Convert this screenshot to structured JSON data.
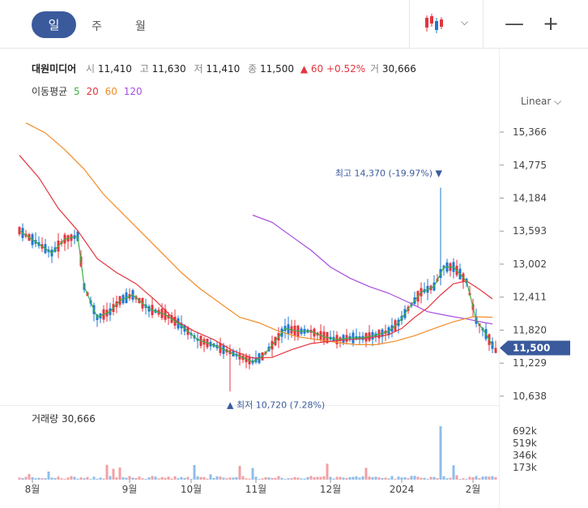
{
  "toolbar": {
    "periods": [
      {
        "label": "일",
        "active": true
      },
      {
        "label": "주",
        "active": false
      },
      {
        "label": "월",
        "active": false
      }
    ],
    "chart_type_icon": "candlestick-icon",
    "dropdown_icon": "chevron-down-icon",
    "zoom_out": "—",
    "zoom_in": "+"
  },
  "quote": {
    "name": "대원미디어",
    "open_label": "시",
    "open": "11,410",
    "high_label": "고",
    "high": "11,630",
    "low_label": "저",
    "low": "11,410",
    "close_label": "종",
    "close": "11,500",
    "change": "▲ 60",
    "change_pct": "+0.52%",
    "volume_label": "거",
    "volume": "30,666"
  },
  "moving_avg": {
    "label": "이동평균",
    "periods": [
      {
        "label": "5",
        "color": "#3cb043"
      },
      {
        "label": "20",
        "color": "#e5343e"
      },
      {
        "label": "60",
        "color": "#f28c28"
      },
      {
        "label": "120",
        "color": "#a64ddf"
      }
    ]
  },
  "scale_mode": "Linear",
  "colors": {
    "up": "#e5343e",
    "down": "#1f78d1",
    "accent": "#3a5a9c"
  },
  "chart_data": {
    "type": "candlestick",
    "y_ticks": [
      "15,366",
      "14,775",
      "14,184",
      "13,593",
      "13,002",
      "12,411",
      "11,820",
      "11,229",
      "10,638"
    ],
    "y_tick_values": [
      15366,
      14775,
      14184,
      13593,
      13002,
      12411,
      11820,
      11229,
      10638
    ],
    "ylim": [
      10550,
      15700
    ],
    "x_ticks": [
      "8월",
      "9월",
      "10월",
      "11월",
      "12월",
      "2024",
      "2월"
    ],
    "x_tick_index": [
      4,
      34,
      53,
      73,
      96,
      118,
      140
    ],
    "current_price_label": "11,500",
    "current_price": 11500,
    "high_annotation": {
      "label": "최고",
      "value": "14,370 (-19.97%)",
      "price": 14370,
      "index": 130
    },
    "low_annotation": {
      "label": "최저",
      "value": "10,720 (7.28%)",
      "price": 10720,
      "index": 65
    },
    "volume_label": "거래량",
    "volume_value": "30,666",
    "volume_ticks": [
      "692k",
      "519k",
      "346k",
      "173k"
    ],
    "volume_tick_values": [
      692,
      519,
      346,
      173
    ],
    "volume_max": 830,
    "ma5": [
      [
        0,
        13600
      ],
      [
        10,
        13200
      ],
      [
        14,
        13450
      ],
      [
        18,
        13500
      ],
      [
        20,
        12600
      ],
      [
        24,
        12050
      ],
      [
        28,
        12150
      ],
      [
        31,
        12350
      ],
      [
        35,
        12450
      ],
      [
        40,
        12200
      ],
      [
        45,
        12100
      ],
      [
        50,
        11900
      ],
      [
        55,
        11650
      ],
      [
        60,
        11550
      ],
      [
        64,
        11450
      ],
      [
        68,
        11350
      ],
      [
        72,
        11250
      ],
      [
        75,
        11350
      ],
      [
        78,
        11550
      ],
      [
        82,
        11850
      ],
      [
        86,
        11800
      ],
      [
        90,
        11800
      ],
      [
        94,
        11700
      ],
      [
        98,
        11650
      ],
      [
        102,
        11680
      ],
      [
        106,
        11680
      ],
      [
        110,
        11730
      ],
      [
        114,
        11800
      ],
      [
        117,
        11950
      ],
      [
        120,
        12200
      ],
      [
        124,
        12500
      ],
      [
        128,
        12600
      ],
      [
        131,
        12950
      ],
      [
        134,
        12950
      ],
      [
        138,
        12700
      ],
      [
        141,
        12000
      ],
      [
        144,
        11750
      ],
      [
        146,
        11550
      ]
    ],
    "ma20": [
      [
        0,
        14950
      ],
      [
        6,
        14550
      ],
      [
        12,
        14000
      ],
      [
        18,
        13600
      ],
      [
        24,
        13100
      ],
      [
        30,
        12850
      ],
      [
        36,
        12650
      ],
      [
        42,
        12350
      ],
      [
        48,
        12000
      ],
      [
        54,
        11800
      ],
      [
        60,
        11650
      ],
      [
        66,
        11450
      ],
      [
        72,
        11320
      ],
      [
        78,
        11330
      ],
      [
        84,
        11470
      ],
      [
        90,
        11580
      ],
      [
        96,
        11620
      ],
      [
        102,
        11650
      ],
      [
        108,
        11680
      ],
      [
        114,
        11740
      ],
      [
        118,
        11850
      ],
      [
        122,
        12050
      ],
      [
        126,
        12220
      ],
      [
        130,
        12450
      ],
      [
        134,
        12650
      ],
      [
        138,
        12700
      ],
      [
        142,
        12550
      ],
      [
        146,
        12380
      ]
    ],
    "ma60": [
      [
        2,
        15530
      ],
      [
        8,
        15350
      ],
      [
        14,
        15050
      ],
      [
        20,
        14700
      ],
      [
        26,
        14250
      ],
      [
        32,
        13900
      ],
      [
        38,
        13550
      ],
      [
        44,
        13200
      ],
      [
        50,
        12850
      ],
      [
        56,
        12550
      ],
      [
        62,
        12300
      ],
      [
        68,
        12050
      ],
      [
        74,
        11950
      ],
      [
        80,
        11800
      ],
      [
        86,
        11700
      ],
      [
        92,
        11650
      ],
      [
        98,
        11600
      ],
      [
        104,
        11560
      ],
      [
        110,
        11560
      ],
      [
        116,
        11620
      ],
      [
        122,
        11720
      ],
      [
        128,
        11850
      ],
      [
        134,
        11970
      ],
      [
        140,
        12060
      ],
      [
        146,
        12050
      ]
    ],
    "ma120": [
      [
        72,
        13880
      ],
      [
        78,
        13750
      ],
      [
        84,
        13500
      ],
      [
        90,
        13250
      ],
      [
        96,
        12950
      ],
      [
        102,
        12750
      ],
      [
        108,
        12600
      ],
      [
        114,
        12480
      ],
      [
        120,
        12320
      ],
      [
        126,
        12150
      ],
      [
        132,
        12080
      ],
      [
        138,
        12020
      ],
      [
        144,
        11950
      ],
      [
        146,
        11930
      ]
    ]
  }
}
